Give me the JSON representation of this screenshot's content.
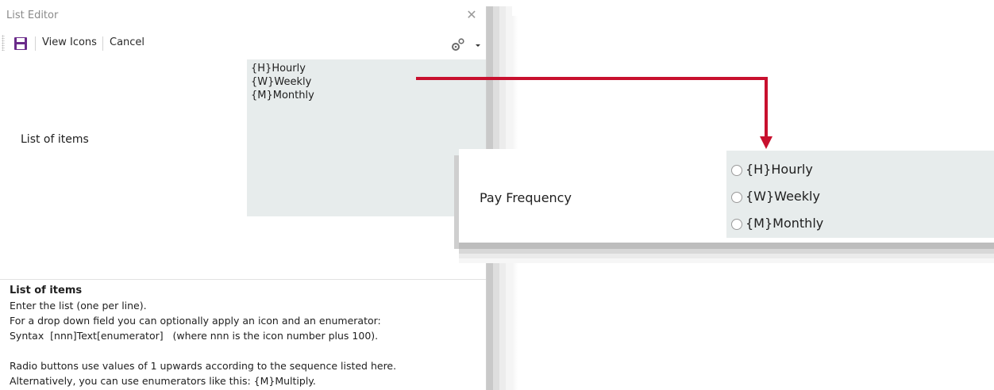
{
  "editor": {
    "title": "List Editor",
    "toolbar": {
      "view_icons_label": "View Icons",
      "cancel_label": "Cancel"
    },
    "field_label": "List of items",
    "list_lines": [
      "{H}Hourly",
      "{W}Weekly",
      "{M}Monthly"
    ],
    "help": {
      "title": "List of items",
      "lines": [
        "Enter the list (one per line).",
        "For a drop down field you can optionally apply an icon and an enumerator:",
        "Syntax  [nnn]Text[enumerator]   (where nnn is the icon number plus 100).",
        "",
        "Radio buttons use values of 1 upwards according to the sequence listed here.",
        "Alternatively, you can use enumerators like this: {M}Multiply."
      ]
    }
  },
  "preview": {
    "field_label": "Pay Frequency",
    "options": [
      "{H}Hourly",
      "{W}Weekly",
      "{M}Monthly"
    ]
  },
  "colors": {
    "arrow": "#c8102e",
    "save_icon": "#6a2b8a",
    "list_bg": "#e7ecec"
  },
  "icons": [
    "save-icon",
    "gear-icon",
    "dropdown-icon",
    "close-icon",
    "radio-icon"
  ]
}
